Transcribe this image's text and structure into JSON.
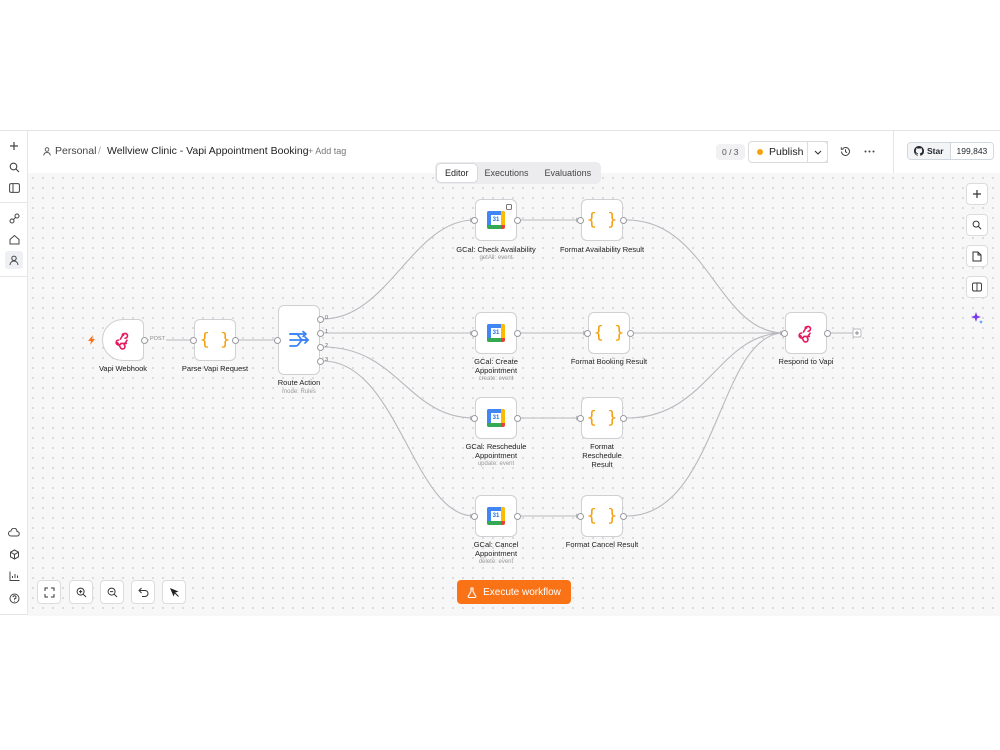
{
  "breadcrumb": {
    "workspace": "Personal",
    "separator": "/"
  },
  "workflow": {
    "title": "Wellview Clinic - Vapi Appointment Booking",
    "add_tag": "+ Add tag"
  },
  "header": {
    "counter": "0 / 3",
    "publish_label": "Publish"
  },
  "github": {
    "star_label": "Star",
    "star_count": "199,843"
  },
  "tabs": [
    {
      "label": "Editor",
      "active": true
    },
    {
      "label": "Executions",
      "active": false
    },
    {
      "label": "Evaluations",
      "active": false
    }
  ],
  "nodes": {
    "vapi_webhook": {
      "label": "Vapi Webhook",
      "icon": "webhook-icon",
      "edge_label": "POST"
    },
    "parse_request": {
      "label": "Parse Vapi Request",
      "icon": "code-braces-icon"
    },
    "route_action": {
      "label": "Route Action",
      "sub": "mode: Rules",
      "icon": "switch-icon",
      "outputs": [
        "0",
        "1",
        "2",
        "3"
      ]
    },
    "gcal_check": {
      "label": "GCal: Check Availability",
      "sub": "getAll: event",
      "icon": "google-calendar-icon"
    },
    "gcal_create": {
      "label": "GCal: Create Appointment",
      "sub": "create: event",
      "icon": "google-calendar-icon"
    },
    "gcal_reschedule": {
      "label": "GCal: Reschedule Appointment",
      "sub": "update: event",
      "icon": "google-calendar-icon"
    },
    "gcal_cancel": {
      "label": "GCal: Cancel Appointment",
      "sub": "delete: event",
      "icon": "google-calendar-icon"
    },
    "format_availability": {
      "label": "Format Availability Result",
      "icon": "code-braces-icon"
    },
    "format_booking": {
      "label": "Format Booking Result",
      "icon": "code-braces-icon"
    },
    "format_reschedule": {
      "label": "Format Reschedule Result",
      "icon": "code-braces-icon"
    },
    "format_cancel": {
      "label": "Format Cancel Result",
      "icon": "code-braces-icon"
    },
    "respond": {
      "label": "Respond to Vapi",
      "icon": "webhook-icon"
    }
  },
  "gcal_day": "31",
  "code_glyph": "{ }",
  "execute_label": "Execute workflow",
  "colors": {
    "accent": "#f97316",
    "publish_dot": "#f5a30b",
    "webhook": "#e5195f",
    "switch": "#3b82f6",
    "code": "#f59e0b"
  }
}
